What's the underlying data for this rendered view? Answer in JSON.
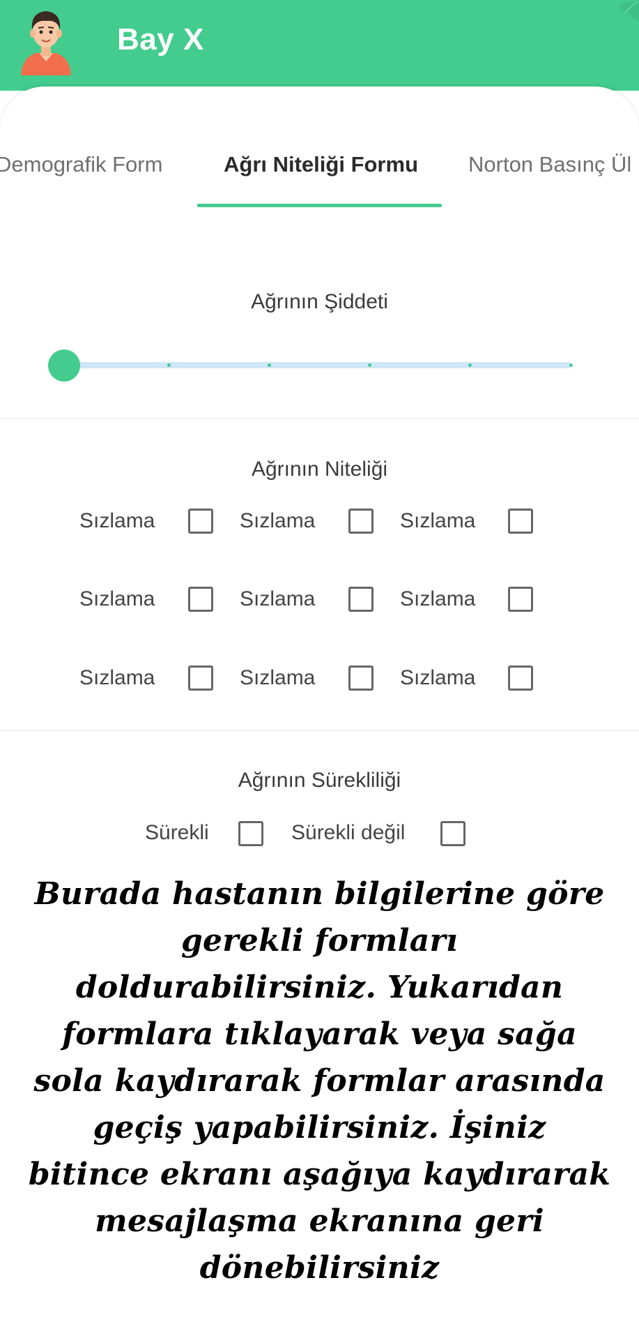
{
  "header": {
    "title": "Bay X",
    "background_color": "#43cc8d",
    "avatar_icon": "user-avatar"
  },
  "tabs": [
    {
      "label": "Demografik Form",
      "active": false
    },
    {
      "label": "Ağrı Niteliği Formu",
      "active": true
    },
    {
      "label": "Norton Basınç Ül",
      "active": false
    }
  ],
  "severity": {
    "title": "Ağrının Şiddeti",
    "slider_value": 0,
    "slider_steps": 5
  },
  "quality": {
    "title": "Ağrının Niteliği",
    "options": [
      {
        "label": "Sızlama",
        "checked": false
      },
      {
        "label": "Sızlama",
        "checked": false
      },
      {
        "label": "Sızlama",
        "checked": false
      },
      {
        "label": "Sızlama",
        "checked": false
      },
      {
        "label": "Sızlama",
        "checked": false
      },
      {
        "label": "Sızlama",
        "checked": false
      },
      {
        "label": "Sızlama",
        "checked": false
      },
      {
        "label": "Sızlama",
        "checked": false
      },
      {
        "label": "Sızlama",
        "checked": false
      }
    ]
  },
  "continuity": {
    "title": "Ağrının Sürekliliği",
    "options": [
      {
        "label": "Sürekli",
        "checked": false
      },
      {
        "label": "Sürekli değil",
        "checked": false
      }
    ]
  },
  "overlay": {
    "text": "Burada hastanın bilgilerine göre gerekli formları doldurabilirsiniz. Yukarıdan formlara tıklayarak veya sağa sola kaydırarak formlar arasında geçiş yapabilirsiniz. İşiniz bitince ekranı aşağıya kaydırarak mesajlaşma ekranına geri dönebilirsiniz"
  },
  "colors": {
    "accent": "#43cc8d",
    "slider_track": "#cfe6f7",
    "checkbox_border": "#666666"
  }
}
